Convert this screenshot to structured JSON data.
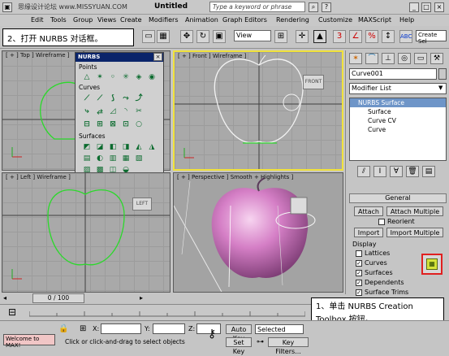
{
  "titlebar": {
    "title": "Untitled",
    "search_placeholder": "Type a keyword or phrase",
    "watermark": "思缘设计论坛 www.MISSYUAN.COM"
  },
  "menu": [
    "Edit",
    "Tools",
    "Group",
    "Views",
    "Create",
    "Modifiers",
    "Animation",
    "Graph Editors",
    "Rendering",
    "Customize",
    "MAXScript",
    "Help"
  ],
  "toolbar": {
    "view_select": "View",
    "create_sel": "Create Sel"
  },
  "callouts": {
    "top": "2、打开 NURBS 对话框。",
    "bottom": "1、单击 NURBS Creation Toolbox 按钮。"
  },
  "viewports": {
    "top": "[ + ] Top ] Wireframe ]",
    "front": "[ + ] Front ] Wireframe ]",
    "left": "[ + ] Left ] Wireframe ]",
    "perspective": "[ + ] Perspective ] Smooth + Highlights ]",
    "cube_front": "FRONT",
    "cube_left": "LEFT"
  },
  "nurbs_panel": {
    "title": "NURBS",
    "points_label": "Points",
    "curves_label": "Curves",
    "surfaces_label": "Surfaces"
  },
  "command_panel": {
    "object_name": "Curve001",
    "modifier_list": "Modifier List",
    "stack": [
      "NURBS Surface",
      "Surface",
      "Curve CV",
      "Curve"
    ],
    "rollout_title": "General",
    "attach": "Attach",
    "attach_multiple": "Attach Multiple",
    "reorient": "Reorient",
    "import": "Import",
    "import_multiple": "Import Multiple",
    "display_label": "Display",
    "display_items": [
      {
        "label": "Lattices",
        "checked": false
      },
      {
        "label": "Curves",
        "checked": true
      },
      {
        "label": "Surfaces",
        "checked": true
      },
      {
        "label": "Dependents",
        "checked": true
      },
      {
        "label": "Surface Trims",
        "checked": true
      }
    ],
    "accent": "#e02020"
  },
  "timeline": {
    "frame": "0 / 100"
  },
  "status": {
    "listener": "Welcome to MAX!",
    "prompt": "Click or click-and-drag to select objects",
    "x_label": "X:",
    "y_label": "Y:",
    "z_label": "Z:",
    "auto_key": "Auto Key",
    "selected": "Selected",
    "set_key": "Set Key",
    "key_filters": "Key Filters..."
  }
}
